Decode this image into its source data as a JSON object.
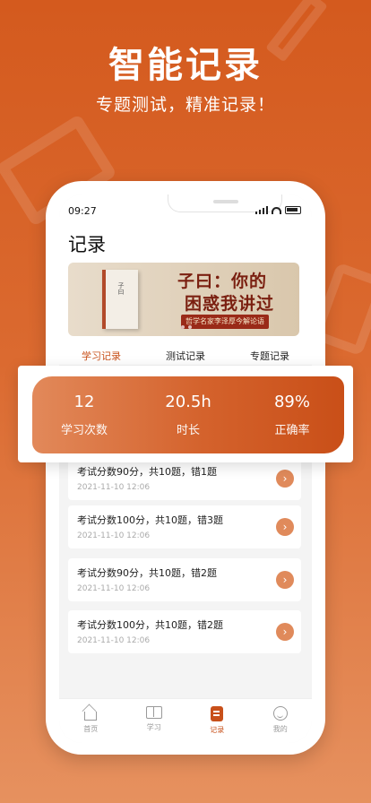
{
  "promo": {
    "headline": "智能记录",
    "subline": "专题测试，精准记录！"
  },
  "status_bar": {
    "time": "09:27"
  },
  "page": {
    "title": "记录"
  },
  "banner": {
    "book_text": "子曰",
    "title_line1": "子曰：你的",
    "title_line2": "困惑我讲过",
    "subtitle": "哲学名家李泽厚今解论语"
  },
  "tabs": [
    {
      "label": "学习记录",
      "active": true
    },
    {
      "label": "测试记录",
      "active": false
    },
    {
      "label": "专题记录",
      "active": false
    }
  ],
  "stats": [
    {
      "value": "12",
      "label": "学习次数"
    },
    {
      "value": "20.5h",
      "label": "时长"
    },
    {
      "value": "89%",
      "label": "正确率"
    }
  ],
  "records": [
    {
      "title": "考试分数90分，共10题，错1题",
      "date": "2021-11-10   12:06"
    },
    {
      "title": "考试分数100分，共10题，错3题",
      "date": "2021-11-10   12:06"
    },
    {
      "title": "考试分数90分，共10题，错2题",
      "date": "2021-11-10   12:06"
    },
    {
      "title": "考试分数100分，共10题，错2题",
      "date": "2021-11-10   12:06"
    }
  ],
  "tabbar": [
    {
      "label": "首页",
      "icon": "home-icon"
    },
    {
      "label": "学习",
      "icon": "book-icon"
    },
    {
      "label": "记录",
      "icon": "record-icon",
      "active": true
    },
    {
      "label": "我的",
      "icon": "profile-icon"
    }
  ],
  "colors": {
    "accent": "#c8501a",
    "background_top": "#d45a1e",
    "background_bottom": "#e6915f"
  }
}
